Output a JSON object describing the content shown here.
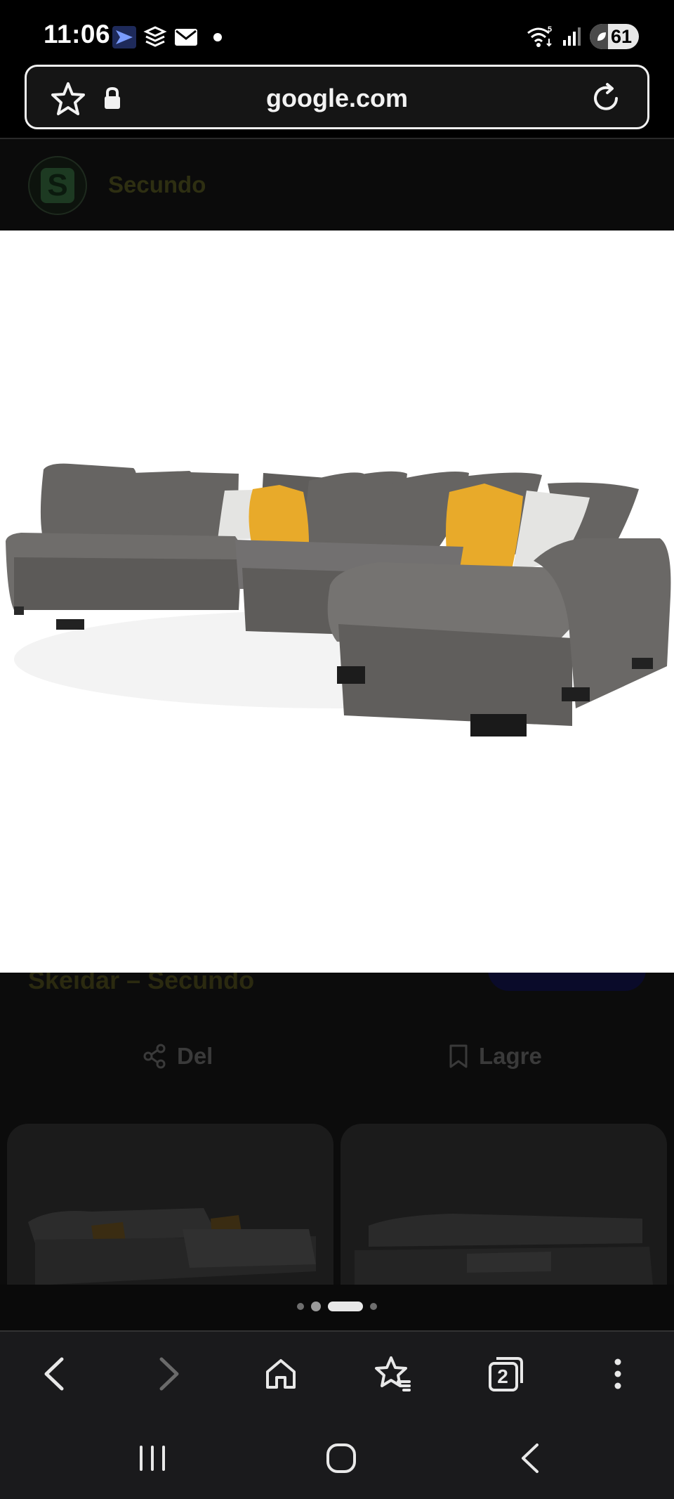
{
  "status_bar": {
    "time": "11:06",
    "battery": "61",
    "icons": [
      "app-notification-icon",
      "stack-app-icon",
      "mail-icon",
      "dot-icon",
      "wifi-5-icon",
      "signal-icon",
      "battery-saver-icon"
    ]
  },
  "url_bar": {
    "domain": "google.com",
    "icons": [
      "star-icon",
      "lock-icon",
      "reload-icon"
    ]
  },
  "site": {
    "name": "Secundo",
    "logo_letter": "S"
  },
  "result": {
    "title_partial": "Skeidar – Secundo"
  },
  "actions": {
    "share_label": "Del",
    "save_label": "Lagre"
  },
  "pagination": {
    "count": 4,
    "active_index": 2
  },
  "toolbar": {
    "tab_count": "2",
    "icons": [
      "back-icon",
      "forward-icon",
      "home-icon",
      "bookmarks-icon",
      "tabs-icon",
      "more-icon"
    ]
  },
  "colors": {
    "cushion_yellow": "#e8aa2a",
    "sofa_grey": "#6f6d6b",
    "cushion_white": "#e4e4e2",
    "background": "#000000"
  }
}
